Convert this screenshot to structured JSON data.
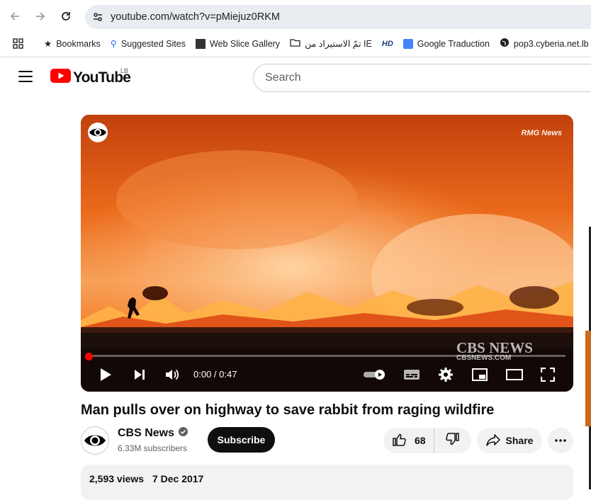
{
  "browser": {
    "url": "youtube.com/watch?v=pMiejuz0RKM",
    "bookmarks": [
      "Bookmarks",
      "Suggested Sites",
      "Web Slice Gallery",
      "تمّ الاستيراد من IE",
      "Google Traduction",
      "pop3.cyberia.net.lb"
    ]
  },
  "youtube": {
    "logo_text": "YouTube",
    "region": "LB",
    "search_placeholder": "Search"
  },
  "player": {
    "watermark_top": "RMG News",
    "watermark_bottom": "CBS NEWS",
    "watermark_bottom_small": "CBSNEWS.COM",
    "time": "0:00 / 0:47",
    "progress": 0
  },
  "video": {
    "title": "Man pulls over on highway to save rabbit from raging wildfire",
    "channel": "CBS News",
    "subscribers": "6.33M subscribers",
    "subscribe_label": "Subscribe",
    "likes": "68",
    "share_label": "Share",
    "views": "2,593 views",
    "date": "7 Dec 2017"
  },
  "colors": {
    "accent": "#ff0000",
    "fire_orange": "#f06b1a"
  }
}
